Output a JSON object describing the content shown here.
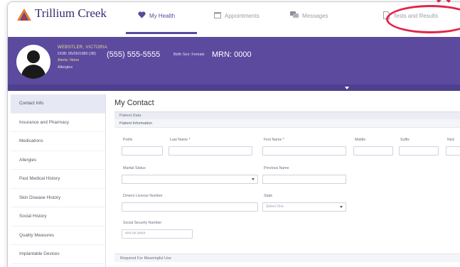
{
  "brand": {
    "name": "Trillium Creek",
    "tagline": "",
    "tagline2": ""
  },
  "nav": [
    {
      "label": "My Health",
      "icon": "heart-icon"
    },
    {
      "label": "Appointments",
      "icon": "calendar-icon"
    },
    {
      "label": "Messages",
      "icon": "messages-icon"
    },
    {
      "label": "Tests and Results",
      "icon": "document-icon"
    }
  ],
  "patient": {
    "name": "WEBSTLER, VICTORIA",
    "dob": "DOB: 05/05/1980 (38)",
    "phone": "(555) 555-5555",
    "birth_sex": "Birth Sex: Female",
    "mrn": "MRN: 0000",
    "flag": "Alerts: None",
    "allergies": "Allergies"
  },
  "sidebar": {
    "items": [
      {
        "label": "Contact Info"
      },
      {
        "label": "Insurance and Pharmacy"
      },
      {
        "label": "Medications"
      },
      {
        "label": "Allergies"
      },
      {
        "label": "Past Medical History"
      },
      {
        "label": "Skin Disease History"
      },
      {
        "label": "Social History"
      },
      {
        "label": "Quality Measures"
      },
      {
        "label": "Implantable Devices"
      }
    ]
  },
  "main": {
    "title": "My Contact",
    "section": "Patient Data",
    "subsection": "Patient Information",
    "fields": {
      "prefix": "Prefix",
      "last_name": "Last Name *",
      "first_name": "First Name *",
      "middle": "Middle",
      "suffix": "Suffix",
      "nickname": "Nick",
      "marital_status": "Marital Status",
      "previous_name": "Previous Name",
      "drivers_license": "Drivers License Number",
      "state": "State",
      "state_value": "Select One",
      "ssn": "Social Security Number",
      "ssn_placeholder": "###-##-####"
    },
    "footer": "Required For Meaningful Use"
  },
  "colors": {
    "brand_purple": "#5b4a9e",
    "highlight_red": "#e0254a",
    "name_gold": "#f3d98a"
  }
}
